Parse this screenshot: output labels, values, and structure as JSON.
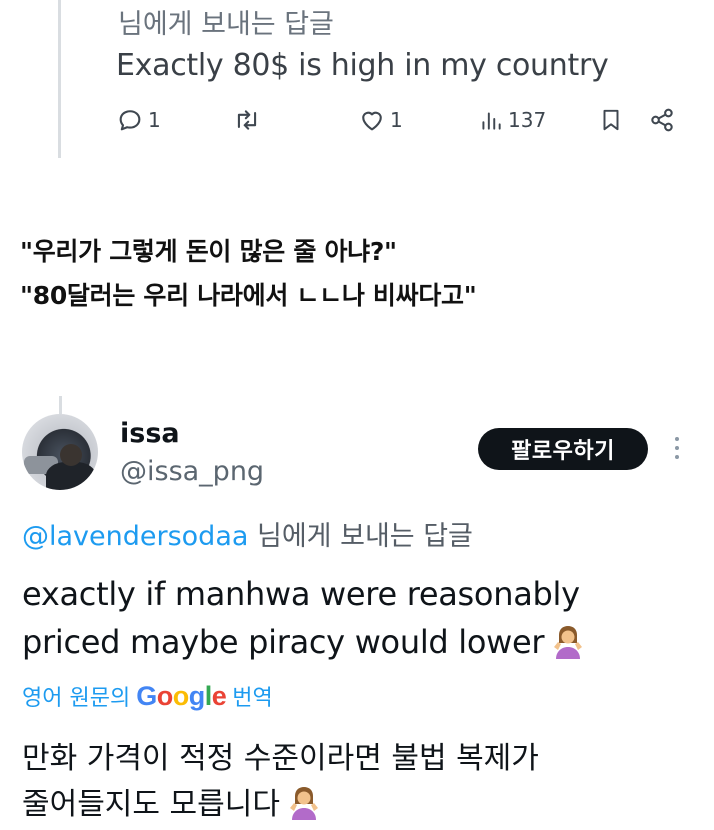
{
  "tweet1": {
    "reply_to": "님에게 보내는 답글",
    "text": "Exactly 80$ is high in my country",
    "actions": {
      "reply_count": "1",
      "retweet_count": "",
      "like_count": "1",
      "views_count": "137"
    },
    "icons": [
      "reply-icon",
      "retweet-icon",
      "like-icon",
      "views-icon",
      "bookmark-icon",
      "share-icon"
    ]
  },
  "caption": {
    "line1": "\"우리가 그렇게 돈이 많은 줄 아냐?\"",
    "line2": "\"80달러는 우리 나라에서 ㄴㄴ나 비싸다고\""
  },
  "tweet2": {
    "name": "issa",
    "handle": "@issa_png",
    "follow_label": "팔로우하기",
    "reply_mention": "@lavendersodaa",
    "reply_suffix": " 님에게 보내는 답글",
    "text_line1": "exactly if manhwa were reasonably",
    "text_line2": "priced maybe piracy would lower",
    "translate_prefix": "영어 원문의",
    "translate_logo": "Google",
    "translate_suffix": "번역",
    "translated_line1": "만화 가격이 적정 수준이라면 불법 복제가",
    "translated_line2": "줄어들지도 모릅니다",
    "emoji": "person-shrugging"
  },
  "colors": {
    "link": "#1d9bf0",
    "text": "#0f1419",
    "muted": "#5b6670",
    "follow_button_bg": "#0f1419"
  }
}
